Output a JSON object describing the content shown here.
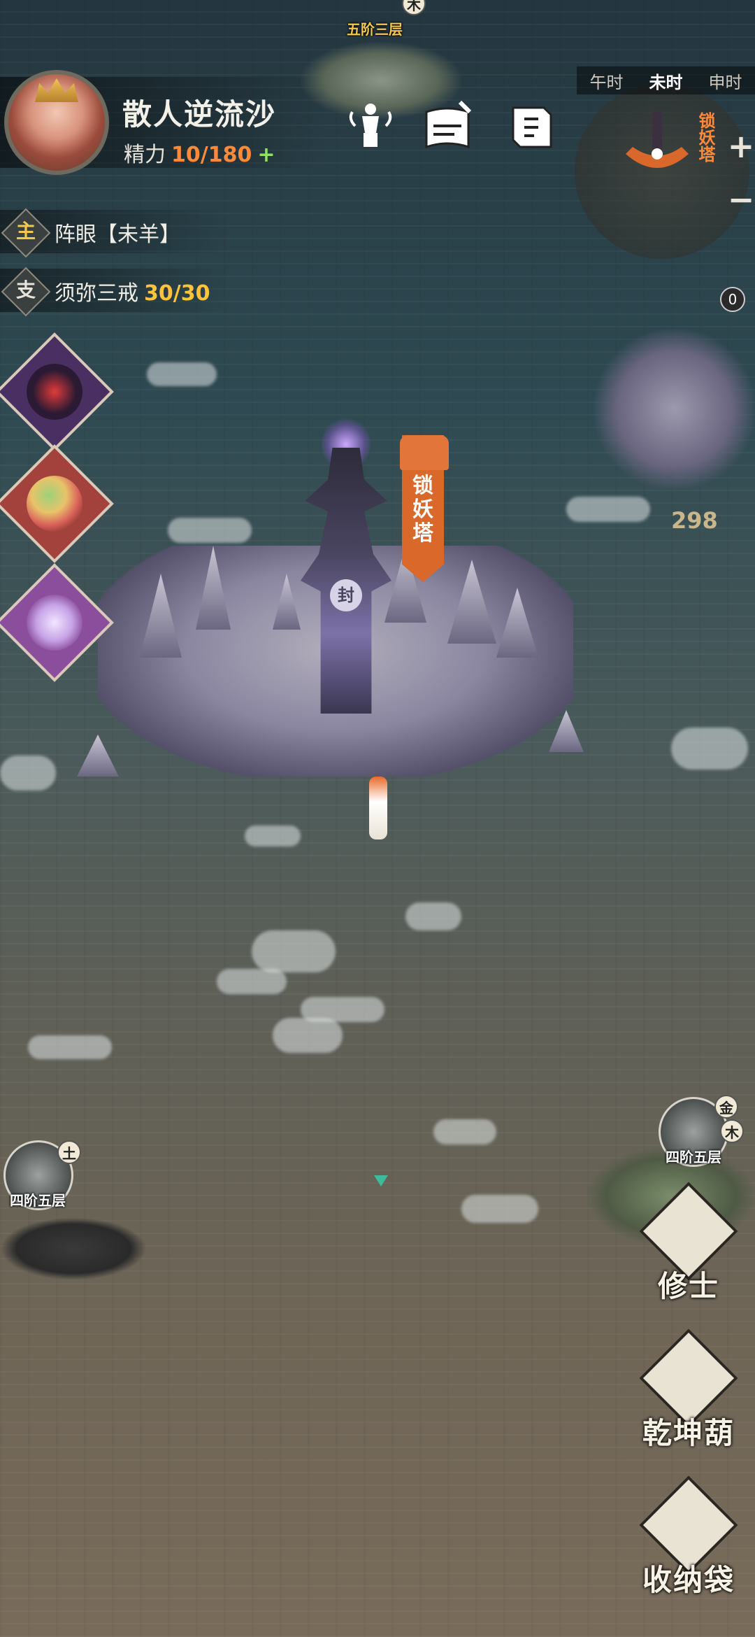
{
  "player": {
    "name": "散人逆流沙",
    "energy_label": "精力",
    "energy_value": "10/180",
    "energy_plus": "+"
  },
  "quests": [
    {
      "tag": "主",
      "tag_color": "#f2c94c",
      "text": "阵眼【未羊】",
      "count": ""
    },
    {
      "tag": "支",
      "tag_color": "#e8e4da",
      "text": "须弥三戒",
      "count": "30/30"
    }
  ],
  "time_bar": {
    "slots": [
      "午时",
      "未时",
      "申时"
    ],
    "current": "未时"
  },
  "minimap": {
    "location_label": "锁妖塔",
    "zoom_in": "+",
    "zoom_out": "−"
  },
  "map": {
    "tower_banner": "锁妖塔",
    "tower_seal": "封",
    "top_location_label": "五阶三层",
    "top_location_element": "木",
    "left_location_label": "四阶五层",
    "left_location_element": "土",
    "right_location_label": "四阶五层",
    "right_location_elements": [
      "金",
      "木"
    ],
    "right_counter": "298",
    "badge_count": "0"
  },
  "actions": {
    "cultivator": "修士",
    "gourd": "乾坤葫",
    "storage_bag": "收纳袋"
  },
  "colors": {
    "energy_value": "#ff8a3a",
    "energy_plus": "#8ee25c",
    "quest_count": "#ffc33a",
    "banner": "#d9682a"
  }
}
